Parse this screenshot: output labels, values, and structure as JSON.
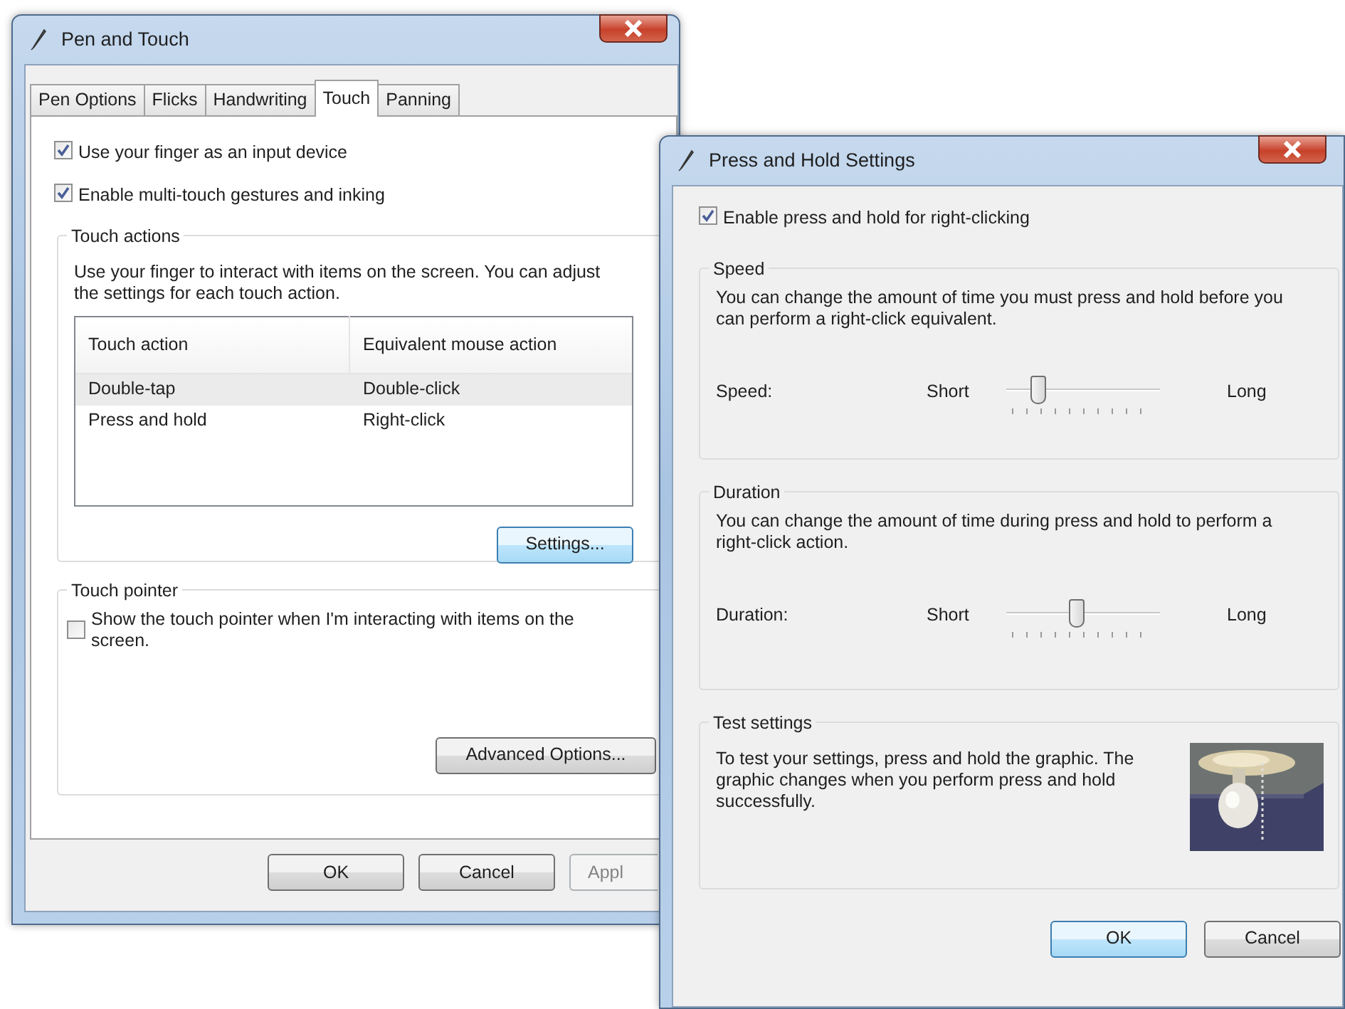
{
  "pen_and_touch": {
    "title": "Pen and Touch",
    "tabs": [
      {
        "label": "Pen Options",
        "selected": false
      },
      {
        "label": "Flicks",
        "selected": false
      },
      {
        "label": "Handwriting",
        "selected": false
      },
      {
        "label": "Touch",
        "selected": true
      },
      {
        "label": "Panning",
        "selected": false
      }
    ],
    "options": [
      {
        "label": "Use your finger as an input device",
        "checked": true
      },
      {
        "label": "Enable multi-touch gestures and inking",
        "checked": true
      }
    ],
    "touch_actions": {
      "title": "Touch actions",
      "description": "Use your finger to interact with items on the screen. You can adjust the settings for each touch action.",
      "columns": [
        "Touch action",
        "Equivalent mouse action"
      ],
      "rows": [
        {
          "cells": [
            "Double-tap",
            "Double-click"
          ],
          "selected": true
        },
        {
          "cells": [
            "Press and hold",
            "Right-click"
          ],
          "selected": false
        }
      ],
      "button": {
        "label": "Settings...",
        "highlighted": true
      }
    },
    "touch_pointer": {
      "title": "Touch pointer",
      "option": {
        "label": "Show the touch pointer when I'm interacting with items on the screen.",
        "checked": false
      },
      "button": {
        "label": "Advanced Options...",
        "highlighted": false
      }
    },
    "buttons": [
      {
        "label": "OK",
        "disabled": false
      },
      {
        "label": "Cancel",
        "disabled": false
      },
      {
        "label": "Appl",
        "disabled": true
      }
    ]
  },
  "press_and_hold": {
    "title": "Press and Hold Settings",
    "enable": {
      "label": "Enable press and hold for right-clicking",
      "checked": true
    },
    "groups": [
      {
        "title": "Speed",
        "description": "You can change the amount of time you must press and hold before you can perform a right-click equivalent.",
        "label": "Speed:",
        "min_label": "Short",
        "max_label": "Long",
        "level": 0.2
      },
      {
        "title": "Duration",
        "description": "You can change the amount of time during press and hold to perform a right-click action.",
        "label": "Duration:",
        "min_label": "Short",
        "max_label": "Long",
        "level": 0.45
      }
    ],
    "test": {
      "title": "Test settings",
      "description": "To test your settings, press and hold the graphic. The graphic changes when you perform press and hold successfully.",
      "kind": "picture"
    },
    "buttons": [
      {
        "label": "OK",
        "default": true
      },
      {
        "label": "Cancel",
        "default": false
      }
    ]
  }
}
